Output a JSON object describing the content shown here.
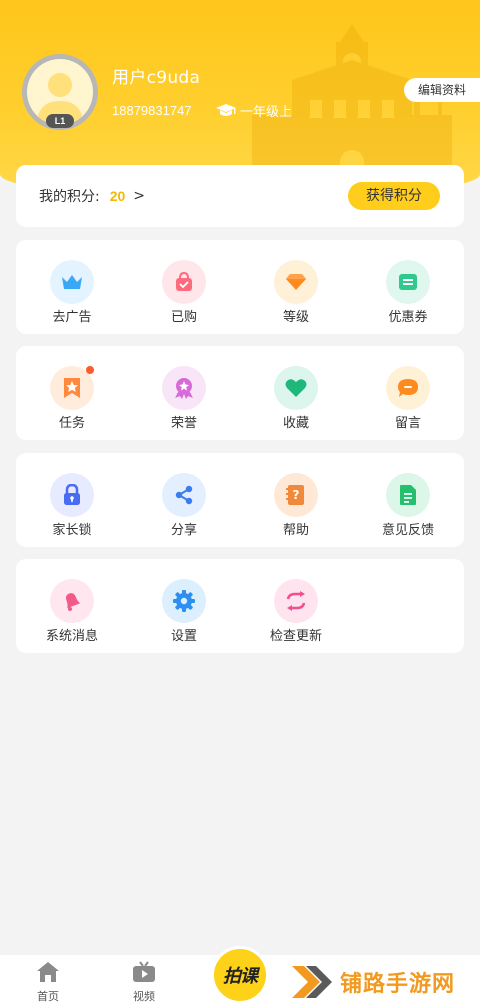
{
  "header": {
    "avatar_level": "L1",
    "username": "用户c9uda",
    "phone": "18879831747",
    "grade": "一年级上",
    "edit_label": "编辑资料"
  },
  "points": {
    "label": "我的积分:",
    "value": "20",
    "earn_label": "获得积分"
  },
  "grid": [
    [
      {
        "label": "去广告",
        "icon": "crown-icon"
      },
      {
        "label": "已购",
        "icon": "shopping-bag-icon"
      },
      {
        "label": "等级",
        "icon": "diamond-icon"
      },
      {
        "label": "优惠券",
        "icon": "coupon-icon"
      }
    ],
    [
      {
        "label": "任务",
        "icon": "task-star-icon"
      },
      {
        "label": "荣誉",
        "icon": "medal-icon"
      },
      {
        "label": "收藏",
        "icon": "heart-icon"
      },
      {
        "label": "留言",
        "icon": "message-icon"
      }
    ],
    [
      {
        "label": "家长锁",
        "icon": "lock-icon"
      },
      {
        "label": "分享",
        "icon": "share-icon"
      },
      {
        "label": "帮助",
        "icon": "help-icon"
      },
      {
        "label": "意见反馈",
        "icon": "feedback-icon"
      }
    ],
    [
      {
        "label": "系统消息",
        "icon": "bell-icon"
      },
      {
        "label": "设置",
        "icon": "gear-icon"
      },
      {
        "label": "检查更新",
        "icon": "refresh-icon"
      }
    ]
  ],
  "nav": {
    "home_label": "首页",
    "video_label": "视频",
    "center_label": "拍课",
    "watermark": "铺路手游网"
  },
  "colors": {
    "accent": "#ffcd1c",
    "points_value": "#f5b800",
    "badge_dot": "#ff5a2a"
  }
}
